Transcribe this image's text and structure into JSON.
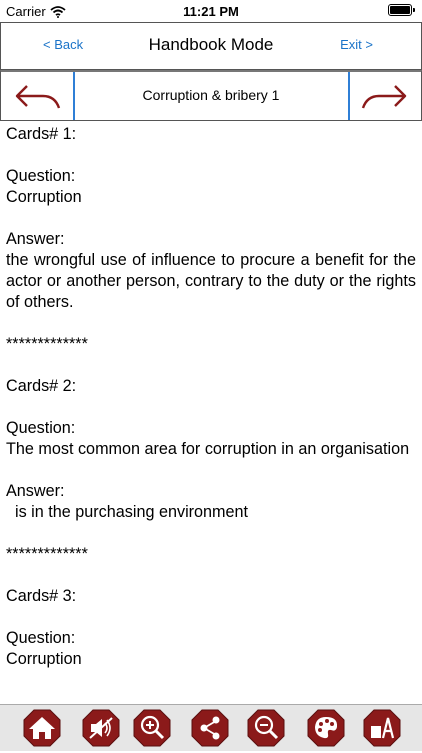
{
  "status_bar": {
    "carrier": "Carrier",
    "time": "11:21 PM"
  },
  "nav": {
    "back_label": "< Back",
    "title": "Handbook Mode",
    "exit_label": "Exit >"
  },
  "card_bar": {
    "title": "Corruption & bribery 1"
  },
  "cards": [
    {
      "header": "Cards# 1:",
      "question_label": "Question:",
      "question": "Corruption",
      "answer_label": "Answer:",
      "answer": "the wrongful use of influence to procure a benefit for the actor or another person, contrary to the duty or the rights of others.",
      "separator": "*************"
    },
    {
      "header": "Cards# 2:",
      "question_label": "Question:",
      "question": "The most common area for corruption in an organisation",
      "answer_label": "Answer:",
      "answer": "  is in the purchasing environment",
      "separator": "*************"
    },
    {
      "header": "Cards# 3:",
      "question_label": "Question:",
      "question": "Corruption"
    }
  ],
  "toolbar": {
    "icons": [
      "home-icon",
      "speaker-mute-icon",
      "zoom-in-icon",
      "share-icon",
      "zoom-out-icon",
      "palette-icon",
      "font-size-icon"
    ]
  },
  "colors": {
    "accent_red": "#8b1a1a",
    "link_blue": "#1a73c8",
    "divider_blue": "#2f7fd6"
  }
}
